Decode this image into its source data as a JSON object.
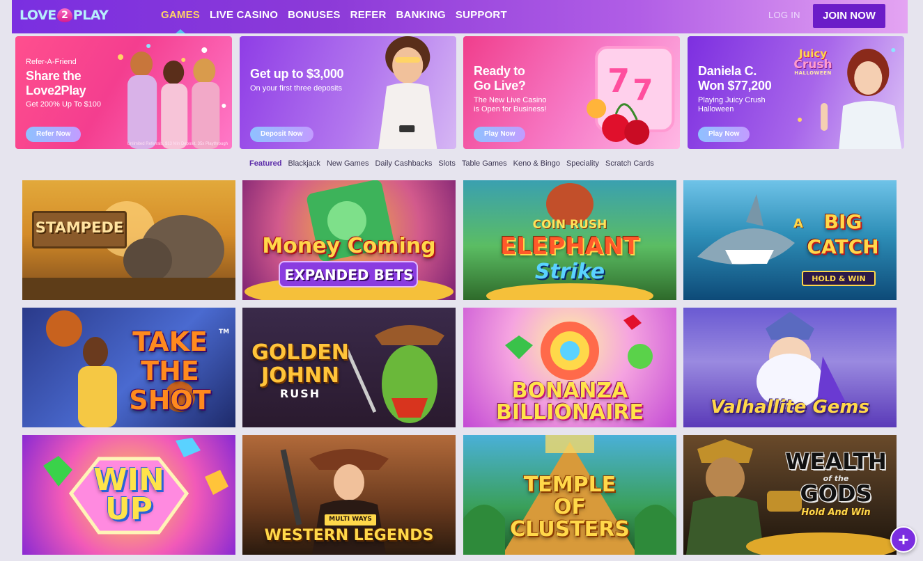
{
  "header": {
    "logo_left": "LOVE",
    "logo_heart": "2",
    "logo_right": "PLAY",
    "nav": [
      {
        "label": "GAMES",
        "active": true
      },
      {
        "label": "LIVE CASINO",
        "active": false
      },
      {
        "label": "BONUSES",
        "active": false
      },
      {
        "label": "REFER",
        "active": false
      },
      {
        "label": "BANKING",
        "active": false
      },
      {
        "label": "SUPPORT",
        "active": false
      }
    ],
    "login_label": "LOG IN",
    "join_label": "JOIN NOW"
  },
  "promos": [
    {
      "eyebrow": "Refer-A-Friend",
      "title": "Share the Love2Play",
      "sub": "Get 200% Up To $100",
      "button": "Refer Now",
      "fine_print": "Unlimited Referrals. $13 Min Deposit. 35x Playthrough"
    },
    {
      "title": "Get up to $3,000",
      "sub": "On your first three deposits",
      "button": "Deposit Now"
    },
    {
      "title": "Ready to Go Live?",
      "sub": "The New Live Casino is Open for Business!",
      "button": "Play Now"
    },
    {
      "title": "Daniela C. Won $77,200",
      "sub": "Playing Juicy Crush Halloween",
      "button": "Play Now",
      "logo_line1": "Juicy",
      "logo_line2": "Crush",
      "logo_line3": "HALLOWEEN"
    }
  ],
  "tabs": [
    {
      "label": "Featured",
      "active": true
    },
    {
      "label": "Blackjack",
      "active": false
    },
    {
      "label": "New Games",
      "active": false
    },
    {
      "label": "Daily Cashbacks",
      "active": false
    },
    {
      "label": "Slots",
      "active": false
    },
    {
      "label": "Table Games",
      "active": false
    },
    {
      "label": "Keno & Bingo",
      "active": false
    },
    {
      "label": "Speciality",
      "active": false
    },
    {
      "label": "Scratch Cards",
      "active": false
    }
  ],
  "games": [
    {
      "title": "STAMPEDE"
    },
    {
      "title": "Money Coming",
      "sub": "EXPANDED BETS"
    },
    {
      "pre": "COIN RUSH",
      "title": "ELEPHANT",
      "sub": "Strike"
    },
    {
      "pre": "A",
      "title": "BIG CATCH",
      "sub": "HOLD & WIN"
    },
    {
      "title": "TAKE THE SHOT",
      "tm": "TM"
    },
    {
      "title": "GOLDEN JOHNN",
      "sub": "RUSH"
    },
    {
      "title": "BONANZA BILLIONAIRE"
    },
    {
      "title": "Valhallite Gems"
    },
    {
      "title": "WIN UP"
    },
    {
      "pre": "MULTI WAYS",
      "title": "WESTERN LEGENDS"
    },
    {
      "title": "TEMPLE OF CLUSTERS"
    },
    {
      "title": "WEALTH",
      "mid": "of the",
      "title2": "GODS",
      "sub": "Hold And Win"
    }
  ],
  "fab": {
    "icon": "plus-icon",
    "label": "+"
  },
  "colors": {
    "header_start": "#7a2fe0",
    "header_end": "#e4a4f2",
    "nav_active": "#ffd466",
    "join_bg": "#6b1cc8",
    "tab_active": "#5a2aa8",
    "page_bg": "#e6e4ee"
  }
}
